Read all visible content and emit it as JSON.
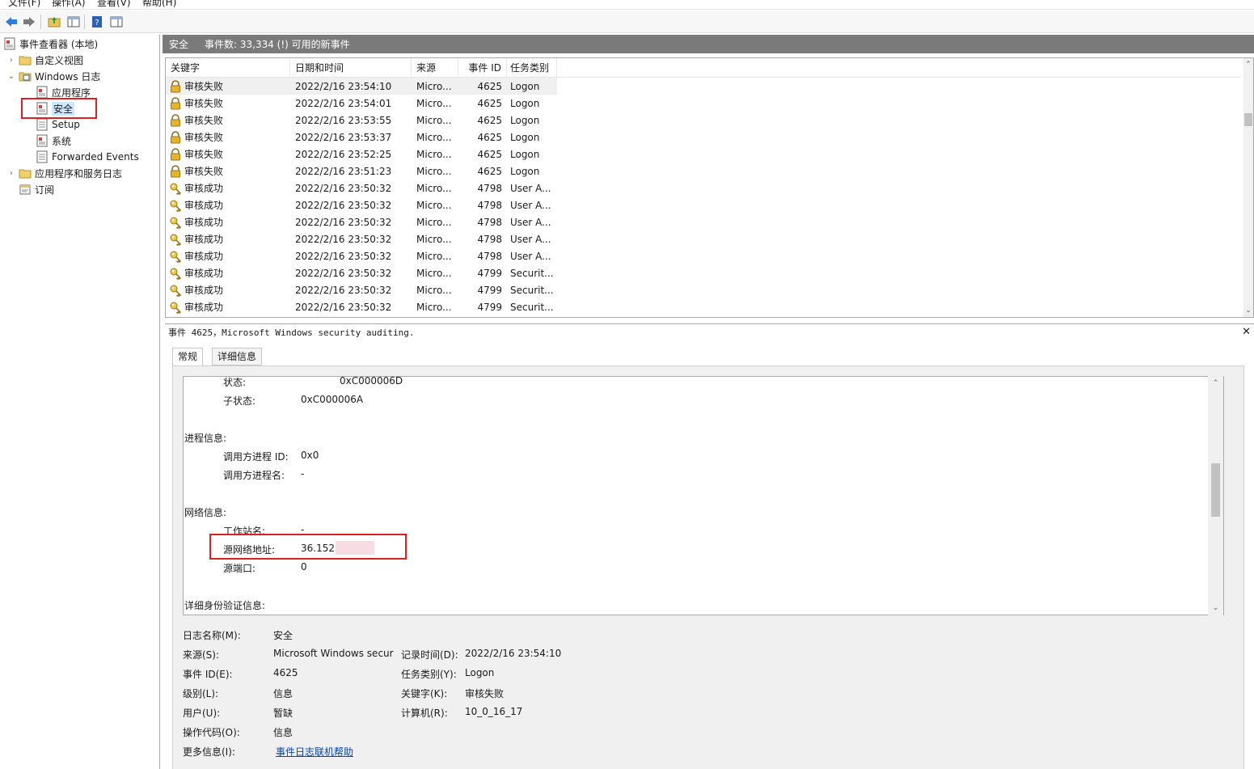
{
  "menu": [
    "文件(F)",
    "操作(A)",
    "查看(V)",
    "帮助(H)"
  ],
  "tree": {
    "root": "事件查看器 (本地)",
    "custom_views": "自定义视图",
    "windows_logs": "Windows 日志",
    "application": "应用程序",
    "security": "安全",
    "setup": "Setup",
    "system": "系统",
    "forwarded": "Forwarded Events",
    "app_service_logs": "应用程序和服务日志",
    "subscriptions": "订阅"
  },
  "pane": {
    "title": "安全",
    "count": "事件数: 33,334 (!) 可用的新事件"
  },
  "grid": {
    "headers": [
      "关键字",
      "日期和时间",
      "来源",
      "事件 ID",
      "任务类别"
    ],
    "rows": [
      {
        "kw": "审核失败",
        "icon": "lock-icon",
        "dt": "2022/2/16 23:54:10",
        "src": "Micro...",
        "id": "4625",
        "task": "Logon"
      },
      {
        "kw": "审核失败",
        "icon": "lock-icon",
        "dt": "2022/2/16 23:54:01",
        "src": "Micro...",
        "id": "4625",
        "task": "Logon"
      },
      {
        "kw": "审核失败",
        "icon": "lock-icon",
        "dt": "2022/2/16 23:53:55",
        "src": "Micro...",
        "id": "4625",
        "task": "Logon"
      },
      {
        "kw": "审核失败",
        "icon": "lock-icon",
        "dt": "2022/2/16 23:53:37",
        "src": "Micro...",
        "id": "4625",
        "task": "Logon"
      },
      {
        "kw": "审核失败",
        "icon": "lock-icon",
        "dt": "2022/2/16 23:52:25",
        "src": "Micro...",
        "id": "4625",
        "task": "Logon"
      },
      {
        "kw": "审核失败",
        "icon": "lock-icon",
        "dt": "2022/2/16 23:51:23",
        "src": "Micro...",
        "id": "4625",
        "task": "Logon"
      },
      {
        "kw": "审核成功",
        "icon": "key-icon",
        "dt": "2022/2/16 23:50:32",
        "src": "Micro...",
        "id": "4798",
        "task": "User A..."
      },
      {
        "kw": "审核成功",
        "icon": "key-icon",
        "dt": "2022/2/16 23:50:32",
        "src": "Micro...",
        "id": "4798",
        "task": "User A..."
      },
      {
        "kw": "审核成功",
        "icon": "key-icon",
        "dt": "2022/2/16 23:50:32",
        "src": "Micro...",
        "id": "4798",
        "task": "User A..."
      },
      {
        "kw": "审核成功",
        "icon": "key-icon",
        "dt": "2022/2/16 23:50:32",
        "src": "Micro...",
        "id": "4798",
        "task": "User A..."
      },
      {
        "kw": "审核成功",
        "icon": "key-icon",
        "dt": "2022/2/16 23:50:32",
        "src": "Micro...",
        "id": "4798",
        "task": "User A..."
      },
      {
        "kw": "审核成功",
        "icon": "key-icon",
        "dt": "2022/2/16 23:50:32",
        "src": "Micro...",
        "id": "4799",
        "task": "Securit..."
      },
      {
        "kw": "审核成功",
        "icon": "key-icon",
        "dt": "2022/2/16 23:50:32",
        "src": "Micro...",
        "id": "4799",
        "task": "Securit..."
      },
      {
        "kw": "审核成功",
        "icon": "key-icon",
        "dt": "2022/2/16 23:50:32",
        "src": "Micro...",
        "id": "4799",
        "task": "Securit..."
      }
    ]
  },
  "detail": {
    "title": "事件 4625，Microsoft Windows security auditing.",
    "tabs": [
      "常规",
      "详细信息"
    ],
    "message": {
      "status_label": "状态:",
      "status_value": "0xC000006D",
      "substatus_label": "子状态:",
      "substatus_value": "0xC000006A",
      "process_section": "进程信息:",
      "caller_pid_label": "调用方进程 ID:",
      "caller_pid_value": "0x0",
      "caller_name_label": "调用方进程名:",
      "caller_name_value": "-",
      "network_section": "网络信息:",
      "workstation_label": "工作站名:",
      "workstation_value": "-",
      "src_addr_label": "源网络地址:",
      "src_addr_value": "36.152.",
      "src_port_label": "源端口:",
      "src_port_value": "0",
      "auth_section": "详细身份验证信息:"
    },
    "props": {
      "log_name_label": "日志名称(M):",
      "log_name_value": "安全",
      "source_label": "来源(S):",
      "source_value": "Microsoft Windows secur",
      "recorded_label": "记录时间(D):",
      "recorded_value": "2022/2/16 23:54:10",
      "event_id_label": "事件 ID(E):",
      "event_id_value": "4625",
      "task_label": "任务类别(Y):",
      "task_value": "Logon",
      "level_label": "级别(L):",
      "level_value": "信息",
      "keywords_label": "关键字(K):",
      "keywords_value": "审核失败",
      "user_label": "用户(U):",
      "user_value": "暂缺",
      "computer_label": "计算机(R):",
      "computer_value": "10_0_16_17",
      "opcode_label": "操作代码(O):",
      "opcode_value": "信息",
      "more_info_label": "更多信息(I):",
      "more_info_link": "事件日志联机帮助"
    }
  },
  "colors": {
    "highlight_box": "#e02020",
    "pane_header": "#7a7a7a",
    "selection": "#cce8ff",
    "link": "#0645ad"
  }
}
